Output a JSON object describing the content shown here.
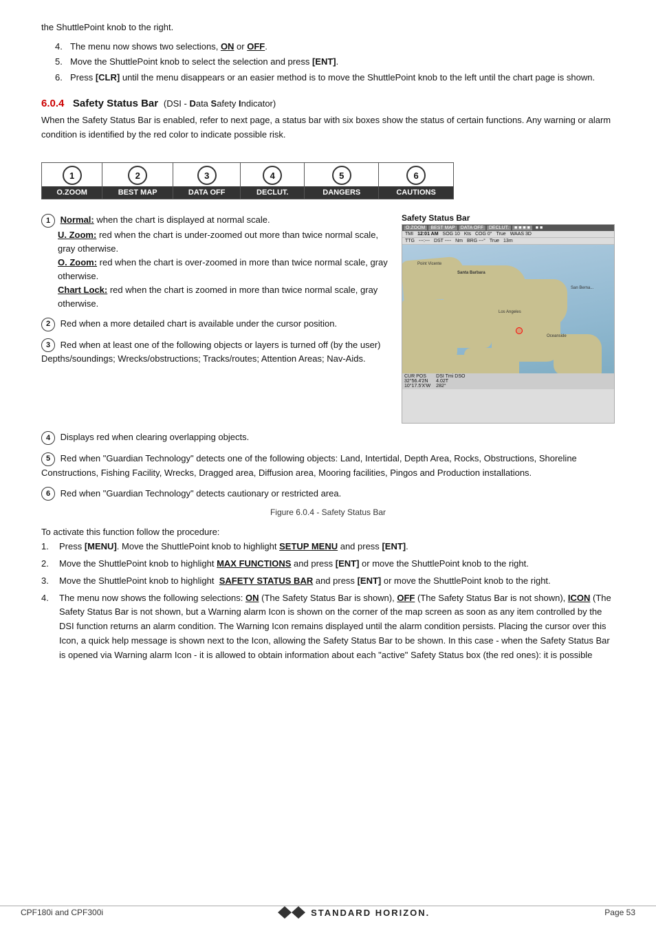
{
  "page": {
    "footer": {
      "left": "CPF180i and CPF300i",
      "right": "Page 53"
    }
  },
  "intro": {
    "text": "the ShuttlePoint knob to the right.",
    "items": [
      {
        "num": "4.",
        "text": "The menu now shows two selections, ",
        "bold1": "ON",
        "bold1_suffix": " or ",
        "bold2": "OFF",
        "bold2_suffix": "."
      },
      {
        "num": "5.",
        "text": "Move the ShuttlePoint knob to select the selection and press ",
        "bold": "[ENT]",
        "suffix": "."
      },
      {
        "num": "6.",
        "text": "Press ",
        "bold1": "[CLR]",
        "mid": " until the menu disappears or an easier method is to move the ShuttlePoint knob to the left until the chart page is shown."
      }
    ]
  },
  "section": {
    "num": "6.0.4",
    "title": "Safety Status Bar",
    "subtitle": "(DSI - ",
    "dsi": "D",
    "dsi2": "ata ",
    "dsi3": "S",
    "dsi4": "afety ",
    "dsi5": "I",
    "dsi6": "ndicator)",
    "description": "When the Safety Status Bar is enabled, refer to next page, a status bar with six boxes show the status of certain functions. Any warning or alarm condition is identified by the red color to indicate possible risk."
  },
  "status_boxes": [
    {
      "num": "1",
      "label": "O.ZOOM"
    },
    {
      "num": "2",
      "label": "BEST MAP"
    },
    {
      "num": "3",
      "label": "DATA OFF"
    },
    {
      "num": "4",
      "label": "DECLUT."
    },
    {
      "num": "5",
      "label": "DANGERS"
    },
    {
      "num": "6",
      "label": "CAUTIONS"
    }
  ],
  "items": [
    {
      "num": "1",
      "intro": "",
      "parts": [
        {
          "label": "Normal:",
          "text": " when the chart is displayed at normal scale."
        },
        {
          "label": "U. Zoom:",
          "text": " red when the chart is under-zoomed out more than twice normal scale, gray otherwise."
        },
        {
          "label": "O. Zoom:",
          "text": " red when the chart is over-zoomed in more than twice normal scale, gray otherwise."
        },
        {
          "label": "Chart Lock:",
          "text": " red when the chart is zoomed in more than twice normal scale, gray otherwise."
        }
      ]
    },
    {
      "num": "2",
      "text": "Red when a more detailed chart is available under the cursor position."
    },
    {
      "num": "3",
      "text": "Red when at least one of the following objects or layers is turned off (by the user) Depths/soundings; Wrecks/obstructions; Tracks/routes; Attention Areas; Nav-Aids."
    },
    {
      "num": "4",
      "text": "Displays red when clearing overlapping objects."
    },
    {
      "num": "5",
      "text": "Red when \"Guardian Technology\" detects one of the following objects: Land, Intertidal, Depth Area, Rocks, Obstructions, Shoreline Constructions, Fishing Facility, Wrecks, Dragged area, Diffusion area, Mooring facilities, Pingos and Production installations."
    },
    {
      "num": "6",
      "text": "Red when \"Guardian Technology\" detects cautionary or restricted area."
    }
  ],
  "figure_caption": "Figure 6.0.4 - Safety Status Bar",
  "safety_status_bar_label": "Safety Status Bar",
  "procedure": {
    "intro": "To activate this function follow the procedure:",
    "items": [
      {
        "num": "1.",
        "text1": "Press ",
        "bold1": "[MENU]",
        "text2": ". Move the ShuttlePoint knob to highlight ",
        "bold2": "SETUP MENU",
        "text3": " and press ",
        "bold3": "[ENT]",
        "text4": "."
      },
      {
        "num": "2.",
        "text1": "Move the ShuttlePoint knob to highlight ",
        "bold1": "MAX FUNCTIONS",
        "text2": " and press ",
        "bold2": "[ENT]",
        "text3": " or move the ShuttlePoint knob to the right."
      },
      {
        "num": "3.",
        "text1": "Move the ShuttlePoint knob to highlight  ",
        "bold1": "SAFETY STATUS BAR",
        "text2": " and press ",
        "bold2": "[ENT]",
        "text3": " or move the ShuttlePoint knob to the right."
      },
      {
        "num": "4.",
        "text1": "The menu now shows the following selections: ",
        "bold1": "ON",
        "text2": " (The Safety Status Bar is shown), ",
        "bold2": "OFF",
        "text3": " (The Safety Status Bar is not shown), ",
        "bold3": "ICON",
        "text4": " (The Safety Status Bar is not shown, but a Warning alarm Icon is shown on the corner of the map screen as soon as any item controlled by the DSI function returns an alarm condition. The Warning Icon remains displayed until the alarm condition persists. Placing the cursor over this Icon, a quick help message is shown next to the Icon, allowing the Safety Status Bar to be shown. In this case - when the Safety Status Bar is opened via Warning alarm Icon - it is allowed to obtain information about each “active” Safety Status box (the red ones): it is possible"
      }
    ]
  }
}
